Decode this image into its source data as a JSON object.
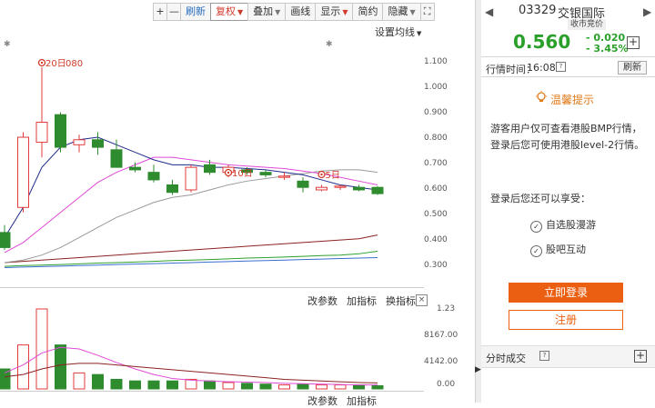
{
  "toolbar": {
    "zoom_in": "+",
    "zoom_out": "—",
    "refresh": "刷新",
    "adjust": "复权",
    "overlay": "叠加",
    "draw": "画线",
    "show": "显示",
    "simple": "简约",
    "hide": "隐藏"
  },
  "chart": {
    "ma_setting": "设置均线",
    "y_ticks": [
      "1.100",
      "1.000",
      "0.900",
      "0.800",
      "0.700",
      "0.600",
      "0.500",
      "0.400",
      "0.300"
    ],
    "annotations": [
      "20日",
      "080",
      "10日",
      "5日"
    ],
    "volume_ticks": [
      "1.23",
      "8167.00",
      "4142.00",
      "0.00"
    ],
    "sub_toolbar": [
      "改参数",
      "加指标",
      "换指标"
    ],
    "sub_toolbar_bottom": [
      "改参数",
      "加指标"
    ],
    "close": "×"
  },
  "chart_data": {
    "type": "candlestick",
    "ylim": [
      0.26,
      1.13
    ],
    "candles": [
      {
        "o": 0.42,
        "h": 0.45,
        "l": 0.35,
        "c": 0.36,
        "up": false
      },
      {
        "o": 0.52,
        "h": 0.82,
        "l": 0.5,
        "c": 0.8,
        "up": true
      },
      {
        "o": 0.78,
        "h": 1.08,
        "l": 0.72,
        "c": 0.86,
        "up": true
      },
      {
        "o": 0.89,
        "h": 0.9,
        "l": 0.74,
        "c": 0.76,
        "up": false
      },
      {
        "o": 0.79,
        "h": 0.81,
        "l": 0.74,
        "c": 0.77,
        "up": true
      },
      {
        "o": 0.79,
        "h": 0.82,
        "l": 0.73,
        "c": 0.76,
        "up": false
      },
      {
        "o": 0.75,
        "h": 0.79,
        "l": 0.69,
        "c": 0.68,
        "up": false
      },
      {
        "o": 0.68,
        "h": 0.7,
        "l": 0.66,
        "c": 0.67,
        "up": false
      },
      {
        "o": 0.66,
        "h": 0.69,
        "l": 0.62,
        "c": 0.63,
        "up": false
      },
      {
        "o": 0.61,
        "h": 0.63,
        "l": 0.57,
        "c": 0.58,
        "up": false
      },
      {
        "o": 0.59,
        "h": 0.69,
        "l": 0.58,
        "c": 0.68,
        "up": true
      },
      {
        "o": 0.69,
        "h": 0.71,
        "l": 0.65,
        "c": 0.66,
        "up": false
      },
      {
        "o": 0.66,
        "h": 0.69,
        "l": 0.64,
        "c": 0.68,
        "up": true
      },
      {
        "o": 0.67,
        "h": 0.68,
        "l": 0.65,
        "c": 0.66,
        "up": false
      },
      {
        "o": 0.66,
        "h": 0.67,
        "l": 0.64,
        "c": 0.65,
        "up": false
      },
      {
        "o": 0.64,
        "h": 0.66,
        "l": 0.63,
        "c": 0.645,
        "up": true
      },
      {
        "o": 0.625,
        "h": 0.64,
        "l": 0.58,
        "c": 0.6,
        "up": false
      },
      {
        "o": 0.6,
        "h": 0.61,
        "l": 0.585,
        "c": 0.59,
        "up": true
      },
      {
        "o": 0.6,
        "h": 0.61,
        "l": 0.59,
        "c": 0.605,
        "up": true
      },
      {
        "o": 0.6,
        "h": 0.61,
        "l": 0.585,
        "c": 0.59,
        "up": false
      },
      {
        "o": 0.6,
        "h": 0.605,
        "l": 0.57,
        "c": 0.575,
        "up": false
      }
    ],
    "volumes": [
      0.25,
      0.55,
      1.0,
      0.55,
      0.2,
      0.18,
      0.12,
      0.1,
      0.1,
      0.1,
      0.12,
      0.1,
      0.08,
      0.07,
      0.06,
      0.05,
      0.06,
      0.05,
      0.05,
      0.05,
      0.04
    ],
    "ma5": [
      0.4,
      0.52,
      0.68,
      0.76,
      0.79,
      0.8,
      0.77,
      0.74,
      0.71,
      0.69,
      0.69,
      0.68,
      0.68,
      0.675,
      0.67,
      0.66,
      0.65,
      0.63,
      0.61,
      0.6,
      0.59
    ],
    "ma10": [
      0.34,
      0.38,
      0.44,
      0.5,
      0.56,
      0.62,
      0.66,
      0.69,
      0.72,
      0.72,
      0.71,
      0.7,
      0.69,
      0.685,
      0.68,
      0.675,
      0.665,
      0.655,
      0.64,
      0.625,
      0.61
    ],
    "ma20": [
      0.3,
      0.31,
      0.33,
      0.36,
      0.4,
      0.44,
      0.48,
      0.51,
      0.54,
      0.56,
      0.57,
      0.59,
      0.61,
      0.625,
      0.635,
      0.645,
      0.655,
      0.665,
      0.67,
      0.67,
      0.66
    ],
    "ma60": [
      0.3,
      0.305,
      0.31,
      0.315,
      0.32,
      0.325,
      0.33,
      0.335,
      0.34,
      0.345,
      0.35,
      0.355,
      0.36,
      0.365,
      0.37,
      0.375,
      0.38,
      0.385,
      0.39,
      0.395,
      0.41
    ],
    "ma120": [
      0.285,
      0.288,
      0.29,
      0.292,
      0.295,
      0.298,
      0.3,
      0.302,
      0.305,
      0.308,
      0.31,
      0.312,
      0.315,
      0.318,
      0.32,
      0.322,
      0.325,
      0.328,
      0.33,
      0.335,
      0.345
    ],
    "ma250": [
      0.28,
      0.282,
      0.284,
      0.286,
      0.288,
      0.29,
      0.292,
      0.294,
      0.296,
      0.298,
      0.3,
      0.302,
      0.304,
      0.306,
      0.308,
      0.31,
      0.312,
      0.314,
      0.316,
      0.318,
      0.32
    ]
  },
  "colors": {
    "up": "#e23b3b",
    "down": "#2e8b2e",
    "ma5": "#1f2a8a",
    "ma10": "#e04ad6",
    "ma20": "#9a9a9a",
    "ma60": "#8b2222",
    "ma120": "#2ea02e",
    "ma250": "#3a6fd0"
  },
  "side": {
    "code": "03329",
    "name": "交银国际",
    "status_tag": "收市竞价",
    "price": "0.560",
    "change": "- 0.020",
    "change_pct": "- 3.45%",
    "time_label": "行情时间：",
    "time_value": "16:08",
    "refresh": "刷新",
    "tip_title": "温馨提示",
    "tip_text": "游客用户仅可查看港股BMP行情，登录后您可使用港股level-2行情。",
    "enjoy": "登录后您还可以享受：",
    "features": [
      "自选股漫游",
      "股吧互动"
    ],
    "login": "立即登录",
    "register": "注册",
    "ticks_title": "分时成交",
    "nav_left": "◀",
    "nav_right": "▶",
    "plus": "+"
  }
}
